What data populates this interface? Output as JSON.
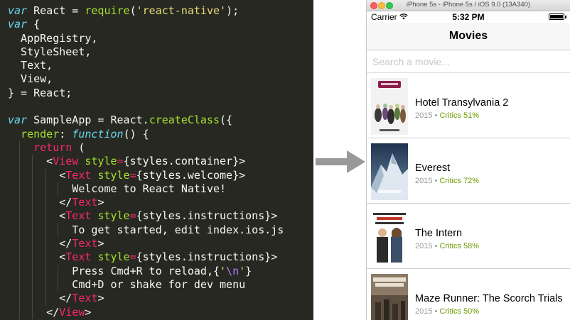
{
  "code_editor": {
    "lines": [
      [
        [
          "kw",
          "var"
        ],
        [
          "plain",
          " React = "
        ],
        [
          "fn",
          "require"
        ],
        [
          "plain",
          "("
        ],
        [
          "str",
          "'react-native'"
        ],
        [
          "plain",
          ");"
        ]
      ],
      [
        [
          "kw",
          "var"
        ],
        [
          "plain",
          " {"
        ]
      ],
      [
        [
          "plain",
          "  AppRegistry,"
        ]
      ],
      [
        [
          "plain",
          "  StyleSheet,"
        ]
      ],
      [
        [
          "plain",
          "  Text,"
        ]
      ],
      [
        [
          "plain",
          "  View,"
        ]
      ],
      [
        [
          "plain",
          "} = React;"
        ]
      ],
      [
        [
          "plain",
          ""
        ]
      ],
      [
        [
          "kw",
          "var"
        ],
        [
          "plain",
          " SampleApp = React."
        ],
        [
          "fn",
          "createClass"
        ],
        [
          "plain",
          "({"
        ]
      ],
      [
        [
          "plain",
          "  "
        ],
        [
          "attr",
          "render"
        ],
        [
          "plain",
          ": "
        ],
        [
          "kw",
          "function"
        ],
        [
          "plain",
          "() {"
        ]
      ],
      [
        [
          "plain",
          "    "
        ],
        [
          "ret",
          "return"
        ],
        [
          "plain",
          " ("
        ]
      ],
      [
        [
          "plain",
          "      <"
        ],
        [
          "tag",
          "View"
        ],
        [
          "plain",
          " "
        ],
        [
          "attr",
          "style"
        ],
        [
          "op",
          "="
        ],
        [
          "plain",
          "{styles.container}>"
        ]
      ],
      [
        [
          "plain",
          "        <"
        ],
        [
          "tag",
          "Text"
        ],
        [
          "plain",
          " "
        ],
        [
          "attr",
          "style"
        ],
        [
          "op",
          "="
        ],
        [
          "plain",
          "{styles.welcome}>"
        ]
      ],
      [
        [
          "plain",
          "          Welcome to React Native!"
        ]
      ],
      [
        [
          "plain",
          "        </"
        ],
        [
          "tag",
          "Text"
        ],
        [
          "plain",
          ">"
        ]
      ],
      [
        [
          "plain",
          "        <"
        ],
        [
          "tag",
          "Text"
        ],
        [
          "plain",
          " "
        ],
        [
          "attr",
          "style"
        ],
        [
          "op",
          "="
        ],
        [
          "plain",
          "{styles.instructions}>"
        ]
      ],
      [
        [
          "plain",
          "          To get started, edit index.ios.js"
        ]
      ],
      [
        [
          "plain",
          "        </"
        ],
        [
          "tag",
          "Text"
        ],
        [
          "plain",
          ">"
        ]
      ],
      [
        [
          "plain",
          "        <"
        ],
        [
          "tag",
          "Text"
        ],
        [
          "plain",
          " "
        ],
        [
          "attr",
          "style"
        ],
        [
          "op",
          "="
        ],
        [
          "plain",
          "{styles.instructions}>"
        ]
      ],
      [
        [
          "plain",
          "          Press Cmd+R to reload,{"
        ],
        [
          "str",
          "'"
        ],
        [
          "esc",
          "\\n"
        ],
        [
          "str",
          "'"
        ],
        [
          "plain",
          "}"
        ]
      ],
      [
        [
          "plain",
          "          Cmd+D or shake for dev menu"
        ]
      ],
      [
        [
          "plain",
          "        </"
        ],
        [
          "tag",
          "Text"
        ],
        [
          "plain",
          ">"
        ]
      ],
      [
        [
          "plain",
          "      </"
        ],
        [
          "tag",
          "View"
        ],
        [
          "plain",
          ">"
        ]
      ]
    ],
    "colors": {
      "background": "#272822",
      "keyword": "#66d9ef",
      "string": "#e6db74",
      "function": "#a6e22e",
      "tag": "#f92672",
      "escape": "#ae81ff"
    }
  },
  "simulator": {
    "window_title": "iPhone 5s - iPhone 5s / iOS 9.0 (13A340)",
    "status_bar": {
      "carrier": "Carrier",
      "time": "5:32 PM"
    },
    "nav_title": "Movies",
    "search": {
      "placeholder": "Search a movie...",
      "value": ""
    },
    "movies": [
      {
        "title": "Hotel Transylvania 2",
        "year": "2015",
        "separator": " • ",
        "critics": "Critics 51%"
      },
      {
        "title": "Everest",
        "year": "2015",
        "separator": " • ",
        "critics": "Critics 72%"
      },
      {
        "title": "The Intern",
        "year": "2015",
        "separator": " • ",
        "critics": "Critics 58%"
      },
      {
        "title": "Maze Runner: The Scorch Trials",
        "year": "2015",
        "separator": " • ",
        "critics": "Critics 50%"
      }
    ],
    "colors": {
      "critics": "#6a9b00",
      "meta": "#999999"
    }
  }
}
